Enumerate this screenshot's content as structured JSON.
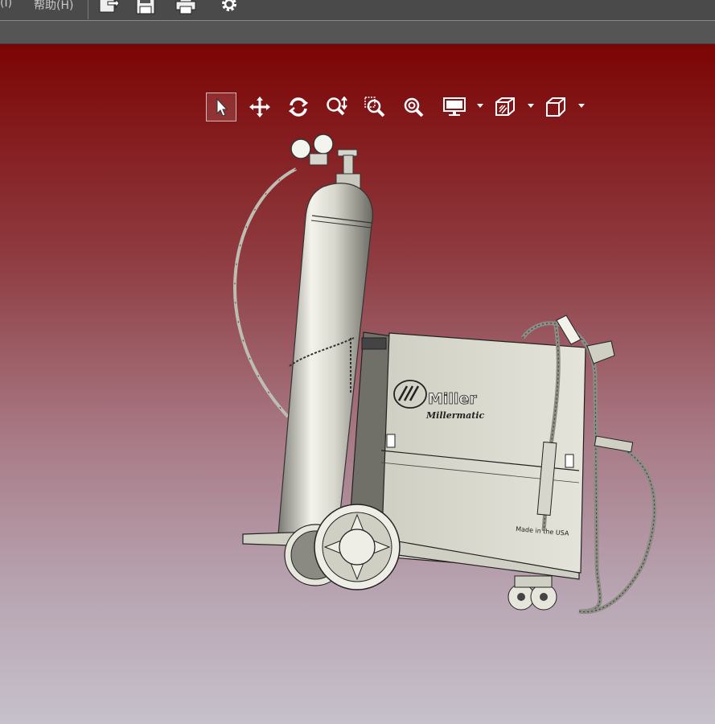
{
  "menubar": {
    "items": [
      {
        "label": "(I)"
      },
      {
        "label": "帮助(H)"
      }
    ],
    "toolbar_icons": [
      "export-icon",
      "save-icon",
      "print-icon",
      "settings-gear-icon"
    ]
  },
  "viewport": {
    "background_colors": [
      "#7c0404",
      "#b9a7b4",
      "#c6c1cb"
    ],
    "tools": [
      {
        "name": "select-arrow-icon",
        "active": true
      },
      {
        "name": "pan-move-icon"
      },
      {
        "name": "rotate-icon"
      },
      {
        "name": "zoom-in-out-icon"
      },
      {
        "name": "zoom-window-icon"
      },
      {
        "name": "zoom-fit-icon"
      },
      {
        "name": "display-mode-icon",
        "dropdown": true
      },
      {
        "name": "section-view-icon",
        "dropdown": true
      },
      {
        "name": "view-orientation-cube-icon",
        "dropdown": true
      }
    ]
  },
  "model": {
    "brand": "Miller",
    "product": "Millermatic",
    "label": "Made in the USA"
  }
}
